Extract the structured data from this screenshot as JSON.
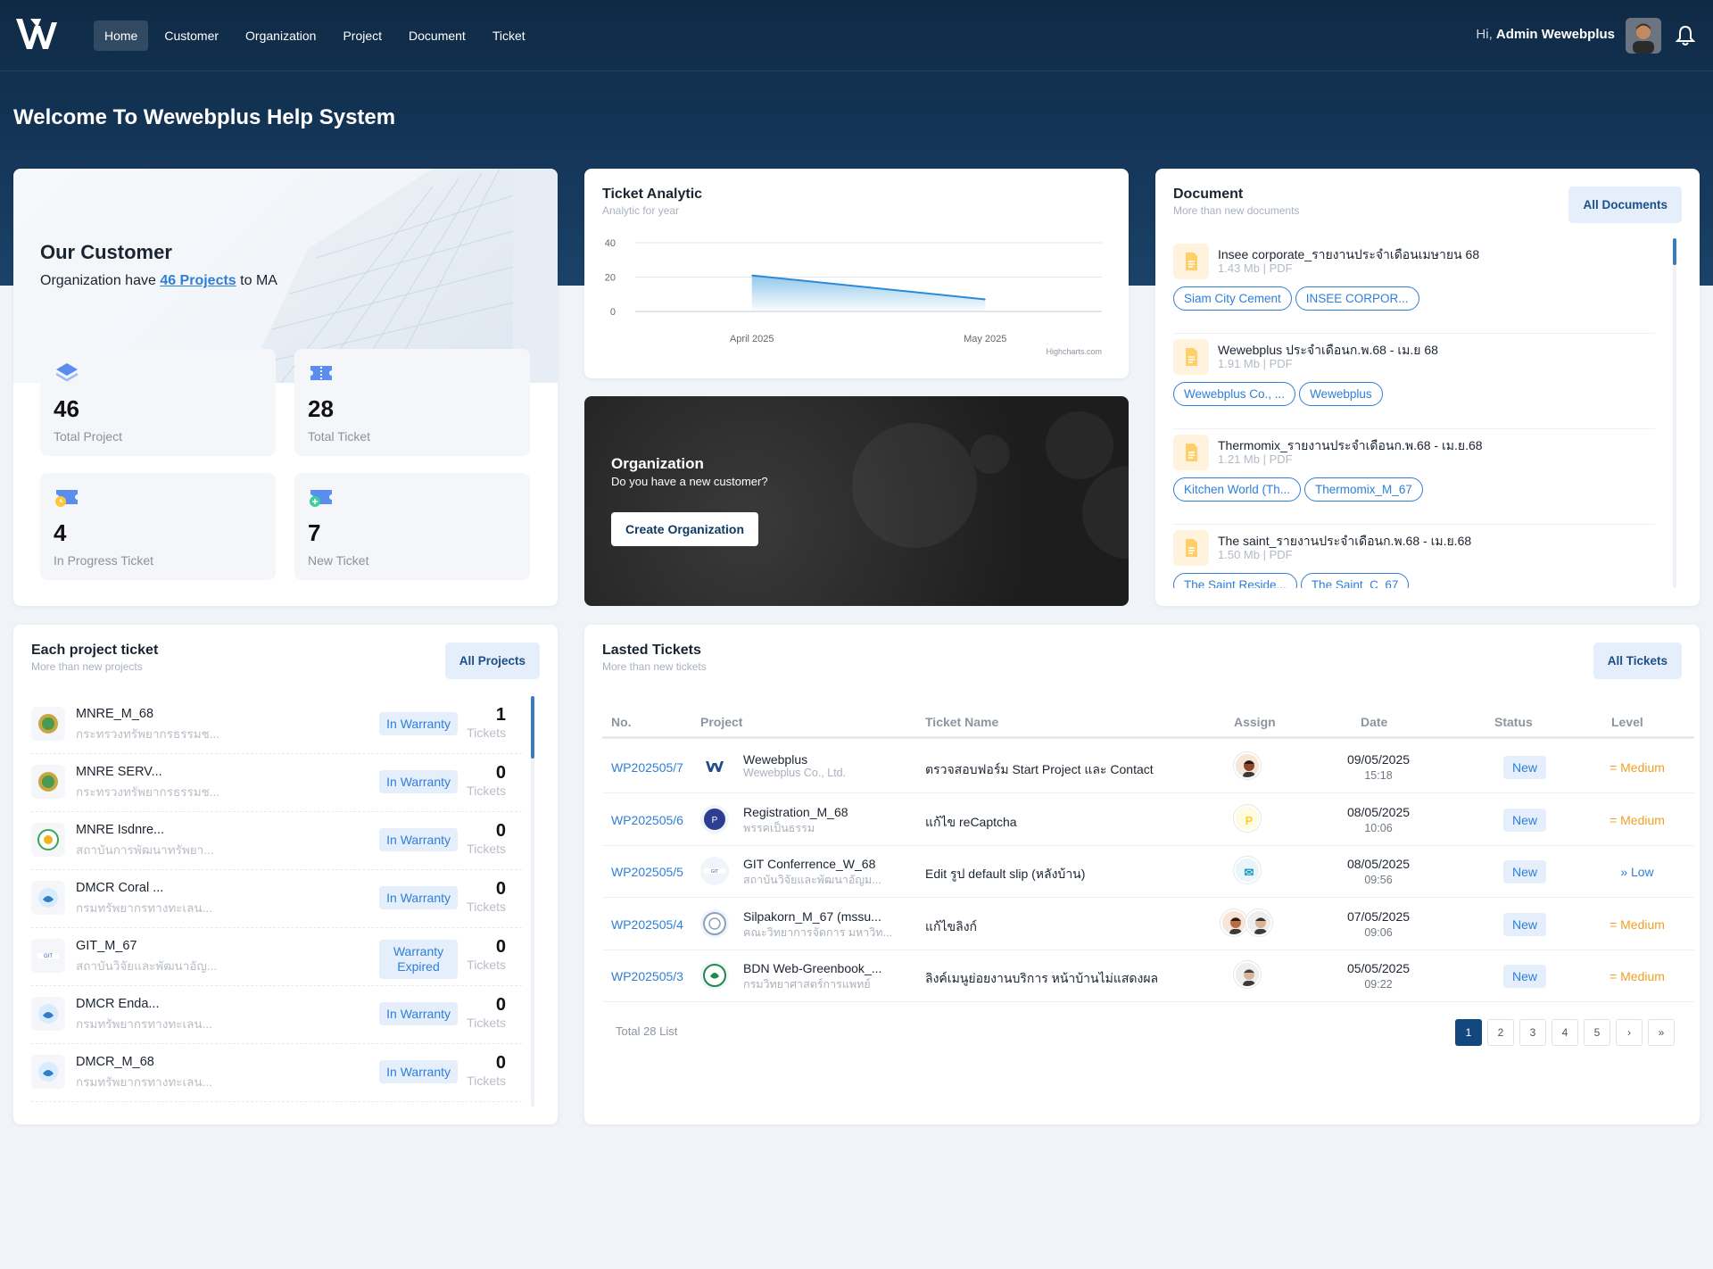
{
  "header": {
    "nav": [
      "Home",
      "Customer",
      "Organization",
      "Project",
      "Document",
      "Ticket"
    ],
    "greeting": "Hi,",
    "user_name": "Admin Wewebplus"
  },
  "welcome": "Welcome To Wewebplus Help System",
  "customer": {
    "title": "Our Customer",
    "desc_prefix": "Organization have",
    "desc_link": "46 Projects",
    "desc_suffix": "to MA",
    "stats": [
      {
        "value": "46",
        "label": "Total Project"
      },
      {
        "value": "28",
        "label": "Total Ticket"
      },
      {
        "value": "4",
        "label": "In Progress Ticket"
      },
      {
        "value": "7",
        "label": "New Ticket"
      }
    ]
  },
  "analytic": {
    "title": "Ticket Analytic",
    "subtitle": "Analytic for year",
    "credit": "Highcharts.com"
  },
  "chart_data": {
    "type": "area",
    "categories": [
      "April 2025",
      "May 2025"
    ],
    "values": [
      21,
      7
    ],
    "ylim": [
      0,
      40
    ],
    "yticks": [
      "40",
      "20",
      "0"
    ],
    "grid": true
  },
  "organization": {
    "title": "Organization",
    "subtitle": "Do you have a new customer?",
    "button": "Create Organization"
  },
  "documents": {
    "title": "Document",
    "subtitle": "More than new documents",
    "button": "All Documents",
    "items": [
      {
        "name": "Insee corporate_รายงานประจำเดือนเมษายน 68",
        "meta": "1.43 Mb | PDF",
        "tags": [
          "Siam City Cement",
          "INSEE CORPOR..."
        ]
      },
      {
        "name": "Wewebplus ประจำเดือนก.พ.68 - เม.ย 68",
        "meta": "1.91 Mb | PDF",
        "tags": [
          "Wewebplus Co., ...",
          "Wewebplus"
        ]
      },
      {
        "name": "Thermomix_รายงานประจำเดือนก.พ.68 - เม.ย.68",
        "meta": "1.21 Mb | PDF",
        "tags": [
          "Kitchen World (Th...",
          "Thermomix_M_67"
        ]
      },
      {
        "name": "The saint_รายงานประจำเดือนก.พ.68 - เม.ย.68",
        "meta": "1.50 Mb | PDF",
        "tags": [
          "The Saint Reside...",
          "The Saint_C_67"
        ]
      }
    ]
  },
  "projects": {
    "title": "Each project ticket",
    "subtitle": "More than new projects",
    "button": "All Projects",
    "tickets_label": "Tickets",
    "items": [
      {
        "name": "MNRE_M_68",
        "org": "กระทรวงทรัพยากรธรรมช...",
        "warranty": "In Warranty",
        "count": "1"
      },
      {
        "name": "MNRE SERV...",
        "org": "กระทรวงทรัพยากรธรรมช...",
        "warranty": "In Warranty",
        "count": "0"
      },
      {
        "name": "MNRE Isdnre...",
        "org": "สถาบันการพัฒนาทรัพยา...",
        "warranty": "In Warranty",
        "count": "0"
      },
      {
        "name": "DMCR Coral ...",
        "org": "กรมทรัพยากรทางทะเลน...",
        "warranty": "In Warranty",
        "count": "0"
      },
      {
        "name": "GIT_M_67",
        "org": "สถาบันวิจัยและพัฒนาอัญ...",
        "warranty": "Warranty Expired",
        "count": "0"
      },
      {
        "name": "DMCR Enda...",
        "org": "กรมทรัพยากรทางทะเลน...",
        "warranty": "In Warranty",
        "count": "0"
      },
      {
        "name": "DMCR_M_68",
        "org": "กรมทรัพยากรทางทะเลน...",
        "warranty": "In Warranty",
        "count": "0"
      }
    ]
  },
  "tickets": {
    "title": "Lasted Tickets",
    "subtitle": "More than new tickets",
    "button": "All Tickets",
    "columns": [
      "No.",
      "Project",
      "Ticket Name",
      "Assign",
      "Date",
      "Status",
      "Level"
    ],
    "rows": [
      {
        "no": "WP202505/7",
        "project": "Wewebplus",
        "org": "Wewebplus Co., Ltd.",
        "name": "ตรวจสอบฟอร์ม Start Project และ Contact",
        "date": "09/05/2025",
        "time": "15:18",
        "status": "New",
        "level": "= Medium"
      },
      {
        "no": "WP202505/6",
        "project": "Registration_M_68",
        "org": "พรรคเป็นธรรม",
        "name": "แก้ไข reCaptcha",
        "date": "08/05/2025",
        "time": "10:06",
        "status": "New",
        "level": "= Medium"
      },
      {
        "no": "WP202505/5",
        "project": "GIT Conferrence_W_68",
        "org": "สถาบันวิจัยและพัฒนาอัญม...",
        "name": "Edit รูป default slip (หลังบ้าน)",
        "date": "08/05/2025",
        "time": "09:56",
        "status": "New",
        "level": "» Low"
      },
      {
        "no": "WP202505/4",
        "project": "Silpakorn_M_67 (mssu...",
        "org": "คณะวิทยาการจัดการ มหาวิท...",
        "name": "แก้ไขลิงก์",
        "date": "07/05/2025",
        "time": "09:06",
        "status": "New",
        "level": "= Medium"
      },
      {
        "no": "WP202505/3",
        "project": "BDN Web-Greenbook_...",
        "org": "กรมวิทยาศาสตร์การแพทย์",
        "name": "ลิงค์เมนูย่อยงานบริการ หน้าบ้านไม่แสดงผล",
        "date": "05/05/2025",
        "time": "09:22",
        "status": "New",
        "level": "= Medium"
      }
    ],
    "total": "Total 28 List",
    "pages": [
      "1",
      "2",
      "3",
      "4",
      "5",
      "›",
      "»"
    ]
  }
}
